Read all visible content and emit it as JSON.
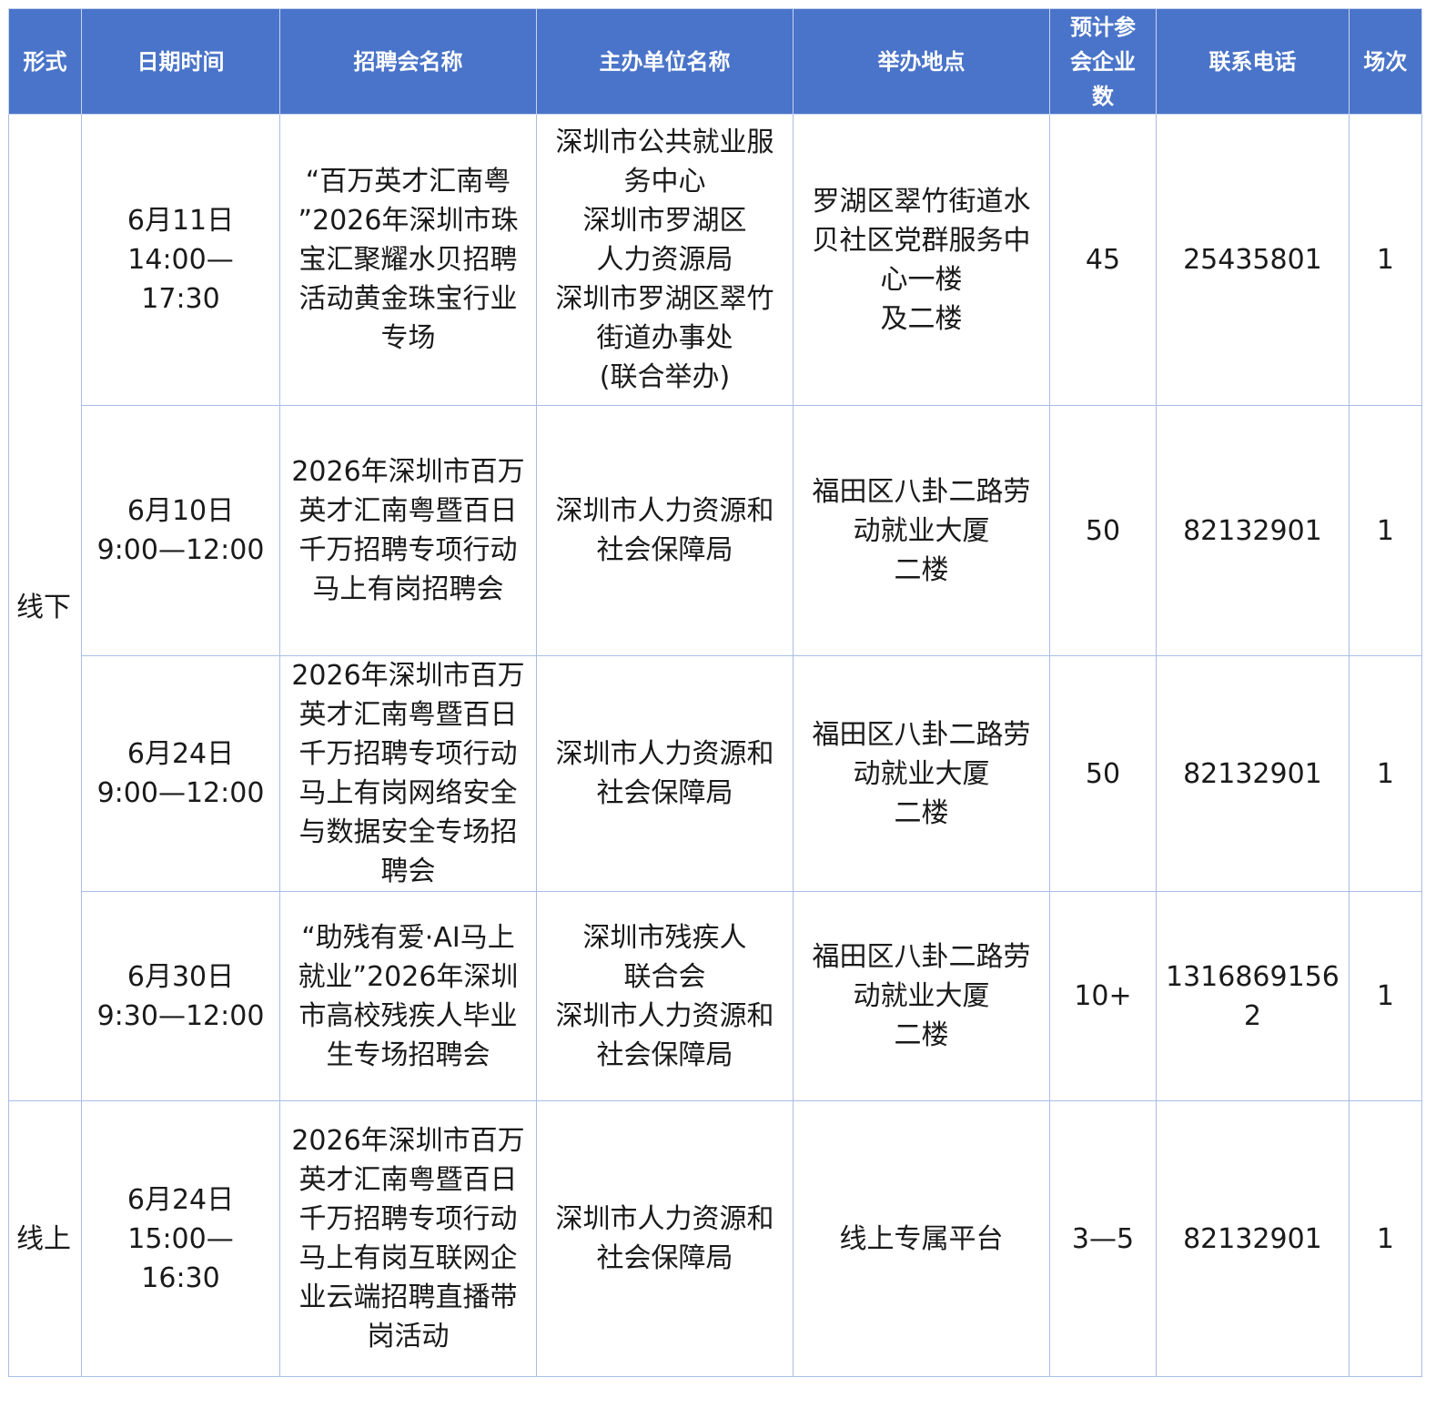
{
  "headers": [
    "形式",
    "日期时间",
    "招聘会名称",
    "主办单位名称",
    "举办地点",
    "预计参会企业数",
    "联系电话",
    "场次"
  ],
  "header_lines": {
    "expected_count": [
      "预计参",
      "会企业",
      "数"
    ]
  },
  "groups": [
    {
      "form": "线下",
      "rows": [
        {
          "date": [
            "6月11日",
            "14:00—",
            "17:30"
          ],
          "name": [
            "“百万英才汇南粤",
            "”2026年深圳市珠",
            "宝汇聚耀水贝招聘",
            "活动黄金珠宝行业",
            "专场"
          ],
          "organizer": [
            "深圳市公共就业服",
            "务中心",
            "深圳市罗湖区",
            "人力资源局",
            "深圳市罗湖区翠竹",
            "街道办事处",
            "(联合举办)"
          ],
          "venue": [
            "罗湖区翠竹街道水",
            "贝社区党群服务中",
            "心一楼",
            "及二楼"
          ],
          "count": "45",
          "phone": [
            "25435801"
          ],
          "sessions": "1"
        },
        {
          "date": [
            "6月10日",
            "9:00—12:00"
          ],
          "name": [
            "2026年深圳市百万",
            "英才汇南粤暨百日",
            "千万招聘专项行动",
            "马上有岗招聘会"
          ],
          "organizer": [
            "深圳市人力资源和",
            "社会保障局"
          ],
          "venue": [
            "福田区八卦二路劳",
            "动就业大厦",
            "二楼"
          ],
          "count": "50",
          "phone": [
            "82132901"
          ],
          "sessions": "1"
        },
        {
          "date": [
            "6月24日",
            "9:00—12:00"
          ],
          "name": [
            "2026年深圳市百万",
            "英才汇南粤暨百日",
            "千万招聘专项行动",
            "马上有岗网络安全",
            "与数据安全专场招",
            "聘会"
          ],
          "organizer": [
            "深圳市人力资源和",
            "社会保障局"
          ],
          "venue": [
            "福田区八卦二路劳",
            "动就业大厦",
            "二楼"
          ],
          "count": "50",
          "phone": [
            "82132901"
          ],
          "sessions": "1"
        },
        {
          "date": [
            "6月30日",
            "9:30—12:00"
          ],
          "name": [
            "“助残有爱·AI马上",
            "就业”2026年深圳",
            "市高校残疾人毕业",
            "生专场招聘会"
          ],
          "organizer": [
            "深圳市残疾人",
            "联合会",
            "深圳市人力资源和",
            "社会保障局"
          ],
          "venue": [
            "福田区八卦二路劳",
            "动就业大厦",
            "二楼"
          ],
          "count": "10+",
          "phone": [
            "1316869156",
            "2"
          ],
          "sessions": "1"
        }
      ]
    },
    {
      "form": "线上",
      "rows": [
        {
          "date": [
            "6月24日",
            "15:00—",
            "16:30"
          ],
          "name": [
            "2026年深圳市百万",
            "英才汇南粤暨百日",
            "千万招聘专项行动",
            "马上有岗互联网企",
            "业云端招聘直播带",
            "岗活动"
          ],
          "organizer": [
            "深圳市人力资源和",
            "社会保障局"
          ],
          "venue": [
            "线上专属平台"
          ],
          "count": "3—5",
          "phone": [
            "82132901"
          ],
          "sessions": "1"
        }
      ]
    }
  ]
}
